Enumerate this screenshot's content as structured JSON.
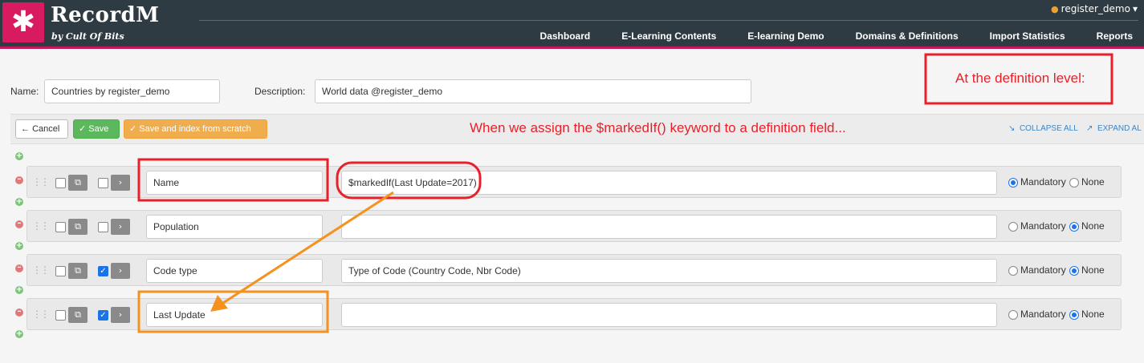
{
  "app": {
    "logo_glyph": "✱",
    "brand": "RecordM",
    "tagline": "by Cult Of Bits",
    "user": "register_demo",
    "user_caret": "▾",
    "nav": [
      "Dashboard",
      "E-Learning Contents",
      "E-learning Demo",
      "Domains & Definitions",
      "Import Statistics",
      "Reports"
    ]
  },
  "form": {
    "name_label": "Name:",
    "name_value": "Countries by register_demo",
    "description_label": "Description:",
    "description_value": "World data @register_demo"
  },
  "toolbar": {
    "cancel_label": "Cancel",
    "save_label": "Save",
    "save_index_label": "Save and index from scratch",
    "collapse_all": "COLLAPSE ALL",
    "expand_all": "EXPAND AL"
  },
  "annotations": {
    "definition_level": "At the definition level:",
    "assign_note": "When we assign the $markedIf() keyword to a definition field..."
  },
  "radio_labels": {
    "mandatory": "Mandatory",
    "none": "None"
  },
  "fields": [
    {
      "name": "Name",
      "description": "$markedIf(Last Update=2017)",
      "checked": false,
      "mandatory": true
    },
    {
      "name": "Population",
      "description": "",
      "checked": false,
      "mandatory": false
    },
    {
      "name": "Code type",
      "description": "Type of Code (Country Code, Nbr Code)",
      "checked": true,
      "mandatory": false
    },
    {
      "name": "Last Update",
      "description": "",
      "checked": true,
      "mandatory": false
    }
  ],
  "colors": {
    "header_bg": "#2f3b42",
    "brand_pink": "#d81b60",
    "annotation_red": "#e8202a",
    "annotation_orange": "#f5921e",
    "save_green": "#5cb85c",
    "index_orange": "#f0ad4e",
    "link_blue": "#3a87c8"
  }
}
